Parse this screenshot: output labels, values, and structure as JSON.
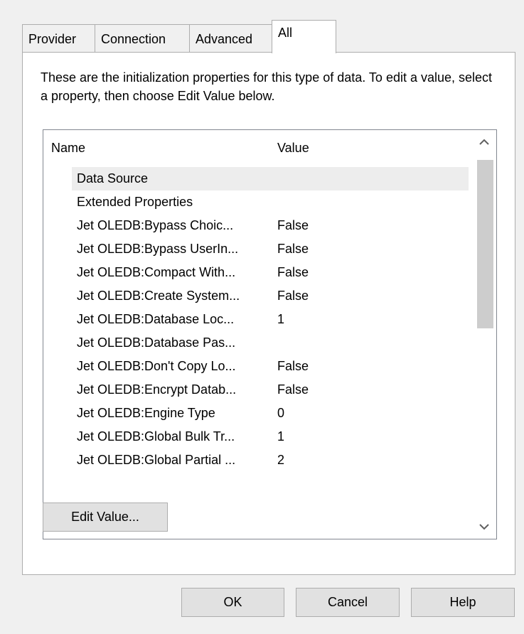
{
  "tabs": [
    {
      "label": "Provider",
      "selected": false
    },
    {
      "label": "Connection",
      "selected": false
    },
    {
      "label": "Advanced",
      "selected": false
    },
    {
      "label": "All",
      "selected": true
    }
  ],
  "description": "These are the initialization properties for this type of data. To edit a value, select a property, then choose Edit Value below.",
  "list": {
    "columns": {
      "name": "Name",
      "value": "Value"
    },
    "rows": [
      {
        "name": "Data Source",
        "value": ""
      },
      {
        "name": "Extended Properties",
        "value": ""
      },
      {
        "name": "Jet OLEDB:Bypass Choic...",
        "value": "False"
      },
      {
        "name": "Jet OLEDB:Bypass UserIn...",
        "value": "False"
      },
      {
        "name": "Jet OLEDB:Compact With...",
        "value": "False"
      },
      {
        "name": "Jet OLEDB:Create System...",
        "value": "False"
      },
      {
        "name": "Jet OLEDB:Database Loc...",
        "value": "1"
      },
      {
        "name": "Jet OLEDB:Database Pas...",
        "value": ""
      },
      {
        "name": "Jet OLEDB:Don't Copy Lo...",
        "value": "False"
      },
      {
        "name": "Jet OLEDB:Encrypt Datab...",
        "value": "False"
      },
      {
        "name": "Jet OLEDB:Engine Type",
        "value": "0"
      },
      {
        "name": "Jet OLEDB:Global Bulk Tr...",
        "value": "1"
      },
      {
        "name": "Jet OLEDB:Global Partial ...",
        "value": "2"
      }
    ],
    "scroll_up_glyph": "^",
    "scroll_down_glyph": "v"
  },
  "buttons": {
    "edit_value": "Edit Value...",
    "ok": "OK",
    "cancel": "Cancel",
    "help": "Help"
  },
  "icons": {
    "scroll_up": "chevron-up-icon",
    "scroll_down": "chevron-down-icon"
  }
}
